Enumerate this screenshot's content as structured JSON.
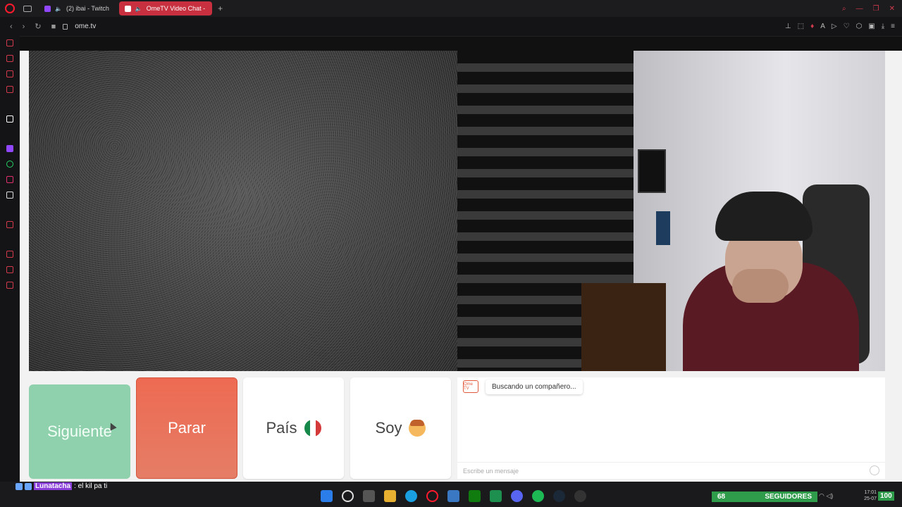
{
  "browser": {
    "tabs": [
      {
        "label": "(2) ibai - Twitch"
      },
      {
        "label": "OmeTV Video Chat -"
      }
    ],
    "url": "ome.tv"
  },
  "controls": {
    "next_label": "Siguiente",
    "stop_label": "Parar",
    "country_label": "País",
    "soy_label": "Soy"
  },
  "chat": {
    "logo_text": "Ome TV",
    "status_message": "Buscando un compañero...",
    "input_placeholder": "Escribe un mensaje"
  },
  "overlay_chat": {
    "user": "Lunatacha",
    "message": ": el kil pa ti"
  },
  "followers_bar": {
    "current": "68",
    "label": "SEGUIDORES",
    "goal": "100"
  },
  "clock": {
    "time": "17:01",
    "date": "25-07"
  },
  "colors": {
    "next_button": "#8fd1ad",
    "stop_button": "#ee6a52",
    "active_tab": "#c8303f",
    "followers": "#2e9c4a"
  }
}
